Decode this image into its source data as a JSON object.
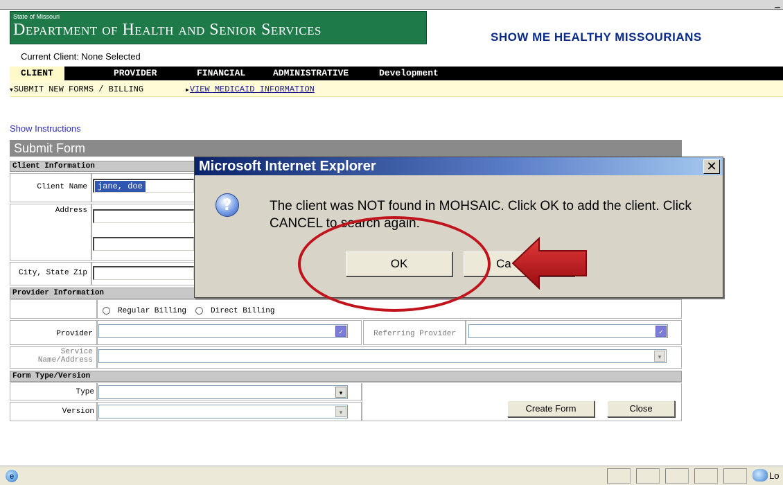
{
  "header": {
    "state_label": "State of Missouri",
    "department": "Department of Health and Senior Services",
    "tagline": "SHOW ME HEALTHY MISSOURIANS",
    "current_client": "Current Client: None Selected"
  },
  "nav": {
    "items": [
      {
        "label": "CLIENT",
        "active": true
      },
      {
        "label": "PROVIDER",
        "active": false
      },
      {
        "label": "FINANCIAL",
        "active": false
      },
      {
        "label": "ADMINISTRATIVE",
        "active": false
      },
      {
        "label": "Development",
        "active": false
      }
    ]
  },
  "subnav": {
    "items": [
      {
        "label": "SUBMIT NEW FORMS / BILLING",
        "indicator": "▼"
      },
      {
        "label": "VIEW MEDICAID INFORMATION",
        "indicator": "▶"
      }
    ]
  },
  "page": {
    "show_instructions": "Show Instructions",
    "form_title": "Submit Form"
  },
  "client_info": {
    "section_label": "Client Information",
    "client_name_label": "Client Name",
    "client_name_value": "jane, doe",
    "address_label": "Address",
    "city_state_zip_label": "City, State Zip"
  },
  "provider_info": {
    "section_label": "Provider Information",
    "regular_billing": "Regular Billing",
    "direct_billing": "Direct Billing",
    "provider_label": "Provider",
    "referring_provider_label": "Referring Provider",
    "service_label_line1": "Service",
    "service_label_line2": "Name/Address"
  },
  "form_type": {
    "section_label": "Form Type/Version",
    "type_label": "Type",
    "version_label": "Version",
    "create_form_button": "Create Form",
    "close_button": "Close"
  },
  "dialog": {
    "title": "Microsoft Internet Explorer",
    "close_glyph": "✕",
    "icon_glyph": "?",
    "message": "The client was NOT found in MOHSAIC. Click OK to add the client. Click CANCEL to search again.",
    "ok_button": "OK",
    "cancel_button_visible": "Ca"
  },
  "annotation": {
    "color": "#c0131b"
  },
  "statusbar": {
    "text": "Lo"
  },
  "icons": {
    "dropdown": "chevron-down-icon",
    "question": "question-icon",
    "ie": "ie-icon",
    "network": "network-icon"
  }
}
